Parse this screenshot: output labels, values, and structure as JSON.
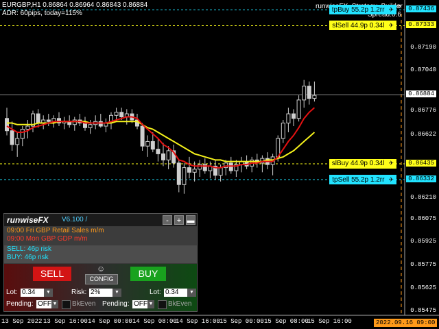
{
  "header": {
    "symbol_line": "EURGBP,H1  0.86864 0.86964 0.86843 0.86884",
    "adr_line": "ADR: 60pips, today=115%",
    "strategy_name": "runwiseFX_Strategy_Builder",
    "spread": "Spread:0.6"
  },
  "price_axis": {
    "labels": [
      "0.87436",
      "0.87333",
      "0.87190",
      "0.87040",
      "0.86884",
      "0.86776",
      "0.86622",
      "0.86435",
      "0.86332",
      "0.86210",
      "0.86075",
      "0.85925",
      "0.85775",
      "0.85625",
      "0.85475"
    ],
    "current": "0.86884"
  },
  "time_axis": {
    "labels": [
      "13 Sep 2022",
      "13 Sep 16:00",
      "14 Sep 00:00",
      "14 Sep 08:00",
      "14 Sep 16:00",
      "15 Sep 00:00",
      "15 Sep 08:00",
      "15 Sep 16:00"
    ],
    "current": "2022.09.16 09:00"
  },
  "levels": [
    {
      "label": "tpBuy 55.2p 1.2rr",
      "price": "0.87436",
      "kind": "tp"
    },
    {
      "label": "slSell 44.9p 0.34l",
      "price": "0.87333",
      "kind": "sl"
    },
    {
      "label": "slBuy 44.9p 0.34l",
      "price": "0.86435",
      "kind": "sl"
    },
    {
      "label": "tpSell 55.2p 1.2rr",
      "price": "0.86332",
      "kind": "tp"
    }
  ],
  "colors": {
    "tp": "#22e3ff",
    "sl": "#ffff19",
    "fast_ma": "#e51212",
    "slow_ma": "#f5f21b",
    "time_tag": "#ff9a1a"
  },
  "panel": {
    "name": "runwiseFX",
    "version": "V6.100 /",
    "buttons": [
      "-",
      "+",
      "▬"
    ],
    "news": [
      {
        "text": "09:00 Fri GBP Retail Sales m/m",
        "color": "#ff9a1a"
      },
      {
        "text": "09:00 Mon GBP GDP m/m",
        "color": "#ff3b2b"
      }
    ],
    "sell_risk": "SELL: 46p risk",
    "buy_risk": "BUY: 46p risk",
    "sell_label": "SELL",
    "buy_label": "BUY",
    "config_label": "CONFIG",
    "smiley": "☺",
    "lot_label": "Lot:",
    "lot_sell": "0.34",
    "lot_buy": "0.34",
    "risk_label": "Risk:",
    "risk_value": "2%",
    "pending_label": "Pending:",
    "pending_sell": "OFF",
    "pending_buy": "OFF",
    "bkeven_label": "BkEven"
  },
  "chart_data": {
    "type": "candlestick",
    "symbol": "EURGBP",
    "timeframe": "H1",
    "ohlc": [
      [
        0.8673,
        0.868,
        0.8662,
        0.8665
      ],
      [
        0.8665,
        0.8671,
        0.8652,
        0.8656
      ],
      [
        0.8656,
        0.8664,
        0.8648,
        0.866
      ],
      [
        0.866,
        0.8668,
        0.8655,
        0.8666
      ],
      [
        0.8666,
        0.8672,
        0.866,
        0.8668
      ],
      [
        0.8668,
        0.8678,
        0.8664,
        0.8676
      ],
      [
        0.8676,
        0.8679,
        0.8667,
        0.867
      ],
      [
        0.867,
        0.8675,
        0.8666,
        0.8672
      ],
      [
        0.8672,
        0.8676,
        0.8668,
        0.8671
      ],
      [
        0.8671,
        0.8675,
        0.8667,
        0.8673
      ],
      [
        0.8673,
        0.8677,
        0.8668,
        0.867
      ],
      [
        0.867,
        0.8674,
        0.8666,
        0.8671
      ],
      [
        0.8671,
        0.8675,
        0.8667,
        0.8669
      ],
      [
        0.8669,
        0.8674,
        0.8665,
        0.8672
      ],
      [
        0.8672,
        0.8676,
        0.8668,
        0.867
      ],
      [
        0.867,
        0.8674,
        0.8665,
        0.8667
      ],
      [
        0.8667,
        0.8672,
        0.8663,
        0.8669
      ],
      [
        0.8669,
        0.8675,
        0.8666,
        0.8671
      ],
      [
        0.8671,
        0.8676,
        0.8667,
        0.8668
      ],
      [
        0.8668,
        0.8673,
        0.8664,
        0.867
      ],
      [
        0.867,
        0.8677,
        0.8666,
        0.8675
      ],
      [
        0.8675,
        0.868,
        0.8671,
        0.8677
      ],
      [
        0.8677,
        0.868,
        0.8672,
        0.8674
      ],
      [
        0.8674,
        0.8679,
        0.8669,
        0.8676
      ],
      [
        0.8676,
        0.8679,
        0.867,
        0.8672
      ],
      [
        0.8672,
        0.8676,
        0.8666,
        0.8668
      ],
      [
        0.8668,
        0.867,
        0.8652,
        0.8655
      ],
      [
        0.8655,
        0.8662,
        0.8648,
        0.8658
      ],
      [
        0.8658,
        0.8664,
        0.8651,
        0.8653
      ],
      [
        0.8653,
        0.866,
        0.8645,
        0.865
      ],
      [
        0.865,
        0.8657,
        0.8642,
        0.8646
      ],
      [
        0.8646,
        0.8655,
        0.864,
        0.8652
      ],
      [
        0.8652,
        0.8656,
        0.8641,
        0.8644
      ],
      [
        0.8644,
        0.8646,
        0.8625,
        0.863
      ],
      [
        0.863,
        0.8644,
        0.8624,
        0.8641
      ],
      [
        0.8641,
        0.8648,
        0.8634,
        0.8638
      ],
      [
        0.8638,
        0.8645,
        0.8632,
        0.864
      ],
      [
        0.864,
        0.8646,
        0.8635,
        0.8643
      ],
      [
        0.8643,
        0.8647,
        0.8637,
        0.8639
      ],
      [
        0.8639,
        0.8645,
        0.8634,
        0.8642
      ],
      [
        0.8642,
        0.8646,
        0.8633,
        0.8636
      ],
      [
        0.8636,
        0.8643,
        0.8632,
        0.8641
      ],
      [
        0.8641,
        0.8646,
        0.8636,
        0.8644
      ],
      [
        0.8644,
        0.8648,
        0.8637,
        0.8639
      ],
      [
        0.8639,
        0.8646,
        0.8635,
        0.8643
      ],
      [
        0.8643,
        0.8648,
        0.8638,
        0.8645
      ],
      [
        0.8645,
        0.8649,
        0.864,
        0.8642
      ],
      [
        0.8642,
        0.8648,
        0.8638,
        0.8646
      ],
      [
        0.8646,
        0.865,
        0.8641,
        0.8644
      ],
      [
        0.8644,
        0.8649,
        0.8638,
        0.8647
      ],
      [
        0.8647,
        0.8651,
        0.864,
        0.8643
      ],
      [
        0.8643,
        0.865,
        0.8636,
        0.8648
      ],
      [
        0.8648,
        0.8662,
        0.8645,
        0.866
      ],
      [
        0.866,
        0.8672,
        0.8657,
        0.867
      ],
      [
        0.867,
        0.868,
        0.8664,
        0.8676
      ],
      [
        0.8676,
        0.8679,
        0.8668,
        0.8673
      ],
      [
        0.8673,
        0.8688,
        0.8671,
        0.8685
      ],
      [
        0.8685,
        0.8698,
        0.868,
        0.8694
      ],
      [
        0.8694,
        0.8697,
        0.8682,
        0.8686
      ],
      [
        0.8686,
        0.8697,
        0.8684,
        0.8688
      ]
    ],
    "ma_fast": [
      0.8668,
      0.8666,
      0.8664,
      0.8664,
      0.8665,
      0.8667,
      0.8668,
      0.8669,
      0.867,
      0.8671,
      0.8671,
      0.8671,
      0.8671,
      0.8671,
      0.8671,
      0.867,
      0.867,
      0.867,
      0.867,
      0.867,
      0.8671,
      0.8672,
      0.8673,
      0.8674,
      0.8674,
      0.8673,
      0.8669,
      0.8666,
      0.8663,
      0.866,
      0.8656,
      0.8654,
      0.8651,
      0.8646,
      0.8645,
      0.8643,
      0.8642,
      0.8642,
      0.8642,
      0.8642,
      0.8641,
      0.8641,
      0.8642,
      0.8642,
      0.8642,
      0.8643,
      0.8643,
      0.8644,
      0.8644,
      0.8645,
      0.8645,
      0.8645,
      0.8648,
      0.8653,
      0.8658,
      0.8662,
      0.8667,
      0.8673,
      0.8677,
      0.868
    ],
    "ma_slow": [
      0.867,
      0.867,
      0.8669,
      0.8669,
      0.8669,
      0.8669,
      0.867,
      0.867,
      0.867,
      0.867,
      0.8671,
      0.8671,
      0.8671,
      0.8671,
      0.8671,
      0.8671,
      0.867,
      0.867,
      0.867,
      0.867,
      0.867,
      0.8671,
      0.8671,
      0.8671,
      0.8671,
      0.8671,
      0.8669,
      0.8667,
      0.8666,
      0.8664,
      0.8662,
      0.866,
      0.8658,
      0.8656,
      0.8654,
      0.8652,
      0.865,
      0.8649,
      0.8648,
      0.8647,
      0.8646,
      0.8646,
      0.8645,
      0.8645,
      0.8645,
      0.8645,
      0.8645,
      0.8645,
      0.8645,
      0.8645,
      0.8646,
      0.8646,
      0.8647,
      0.8648,
      0.865,
      0.8652,
      0.8655,
      0.8658,
      0.8661,
      0.8664
    ],
    "ylim": [
      0.8545,
      0.875
    ],
    "grid": false
  }
}
